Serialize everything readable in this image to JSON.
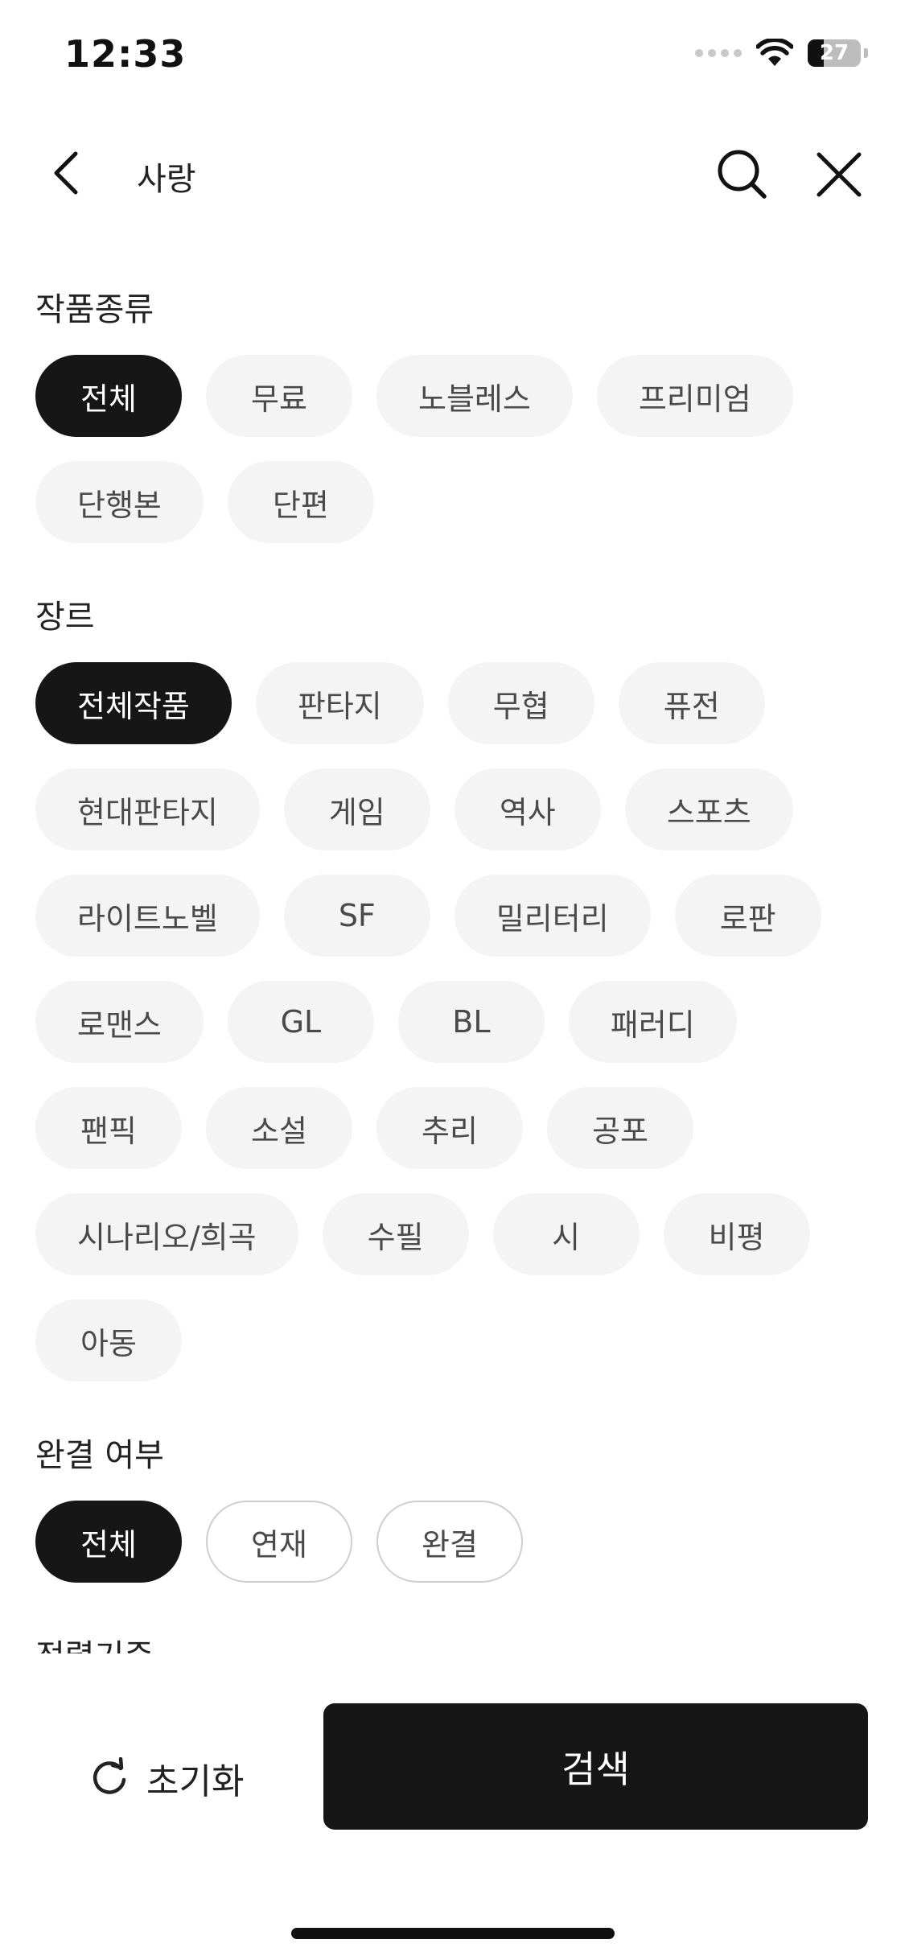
{
  "status_bar": {
    "time": "12:33",
    "battery": "27",
    "battery_level": 0.27
  },
  "header": {
    "query": "사랑",
    "icons": [
      "chevron-left-icon",
      "search-icon",
      "close-icon"
    ]
  },
  "sections": {
    "work_type": {
      "title": "작품종류",
      "chips": [
        "전체",
        "무료",
        "노블레스",
        "프리미엄",
        "단행본",
        "단편"
      ],
      "selected": 0
    },
    "genre": {
      "title": "장르",
      "chips": [
        "전체작품",
        "판타지",
        "무협",
        "퓨전",
        "현대판타지",
        "게임",
        "역사",
        "스포츠",
        "라이트노벨",
        "SF",
        "밀리터리",
        "로판",
        "로맨스",
        "GL",
        "BL",
        "패러디",
        "팬픽",
        "소설",
        "추리",
        "공포",
        "시나리오/희곡",
        "수필",
        "시",
        "비평",
        "아동"
      ],
      "selected": 0
    },
    "completion": {
      "title": "완결 여부",
      "chips": [
        "전체",
        "연재",
        "완결"
      ],
      "selected": 0
    },
    "sort": {
      "title": "정렬기준"
    }
  },
  "bottom_bar": {
    "reset_label": "초기화",
    "search_label": "검색"
  },
  "colors": {
    "selected_chip": "#161616",
    "chip_bg": "#f4f4f4",
    "chip_text": "#4a4a4a"
  }
}
